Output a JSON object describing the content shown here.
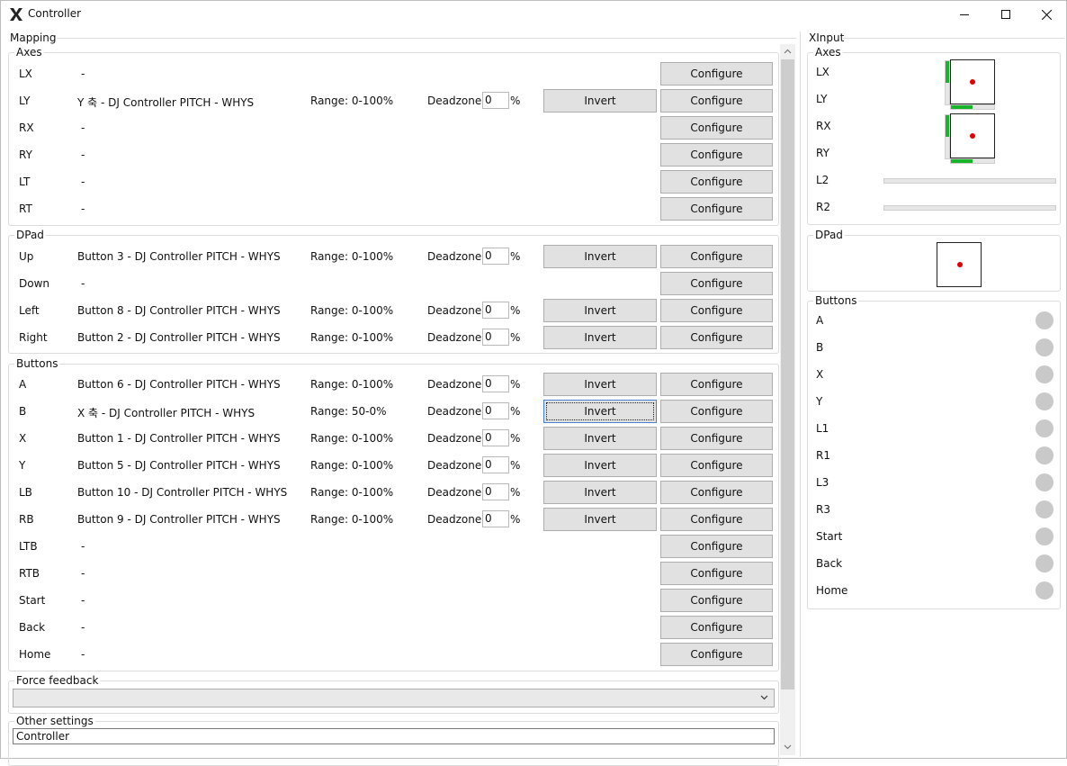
{
  "window": {
    "title": "Controller"
  },
  "mapping": {
    "title": "Mapping",
    "axes_title": "Axes",
    "axes": [
      {
        "name": "LX",
        "source": "-",
        "range": "",
        "deadzone": "",
        "has_invert": false
      },
      {
        "name": "LY",
        "source": "Y 축 - DJ Controller PITCH - WHYS",
        "range": "Range: 0-100%",
        "deadzone": "0",
        "has_invert": true
      },
      {
        "name": "RX",
        "source": "-",
        "range": "",
        "deadzone": "",
        "has_invert": false
      },
      {
        "name": "RY",
        "source": "-",
        "range": "",
        "deadzone": "",
        "has_invert": false
      },
      {
        "name": "LT",
        "source": "-",
        "range": "",
        "deadzone": "",
        "has_invert": false
      },
      {
        "name": "RT",
        "source": "-",
        "range": "",
        "deadzone": "",
        "has_invert": false
      }
    ],
    "dpad_title": "DPad",
    "dpad": [
      {
        "name": "Up",
        "source": "Button 3 - DJ Controller PITCH - WHYS",
        "range": "Range: 0-100%",
        "deadzone": "0",
        "has_invert": true
      },
      {
        "name": "Down",
        "source": "-",
        "range": "",
        "deadzone": "",
        "has_invert": false
      },
      {
        "name": "Left",
        "source": "Button 8 - DJ Controller PITCH - WHYS",
        "range": "Range: 0-100%",
        "deadzone": "0",
        "has_invert": true
      },
      {
        "name": "Right",
        "source": "Button 2 - DJ Controller PITCH - WHYS",
        "range": "Range: 0-100%",
        "deadzone": "0",
        "has_invert": true
      }
    ],
    "buttons_title": "Buttons",
    "buttons": [
      {
        "name": "A",
        "source": "Button 6 - DJ Controller PITCH - WHYS",
        "range": "Range: 0-100%",
        "deadzone": "0",
        "has_invert": true
      },
      {
        "name": "B",
        "source": "X 축 - DJ Controller PITCH - WHYS",
        "range": "Range: 50-0%",
        "deadzone": "0",
        "has_invert": true,
        "focused": true
      },
      {
        "name": "X",
        "source": "Button 1 - DJ Controller PITCH - WHYS",
        "range": "Range: 0-100%",
        "deadzone": "0",
        "has_invert": true
      },
      {
        "name": "Y",
        "source": "Button 5 - DJ Controller PITCH - WHYS",
        "range": "Range: 0-100%",
        "deadzone": "0",
        "has_invert": true
      },
      {
        "name": "LB",
        "source": "Button 10 - DJ Controller PITCH - WHYS",
        "range": "Range: 0-100%",
        "deadzone": "0",
        "has_invert": true
      },
      {
        "name": "RB",
        "source": "Button 9 - DJ Controller PITCH - WHYS",
        "range": "Range: 0-100%",
        "deadzone": "0",
        "has_invert": true
      },
      {
        "name": "LTB",
        "source": "-",
        "range": "",
        "deadzone": "",
        "has_invert": false
      },
      {
        "name": "RTB",
        "source": "-",
        "range": "",
        "deadzone": "",
        "has_invert": false
      },
      {
        "name": "Start",
        "source": "-",
        "range": "",
        "deadzone": "",
        "has_invert": false
      },
      {
        "name": "Back",
        "source": "-",
        "range": "",
        "deadzone": "",
        "has_invert": false
      },
      {
        "name": "Home",
        "source": "-",
        "range": "",
        "deadzone": "",
        "has_invert": false
      }
    ],
    "deadzone_label": "Deadzone:",
    "percent": "%",
    "invert_label": "Invert",
    "configure_label": "Configure",
    "force_feedback_title": "Force feedback",
    "force_feedback_value": "",
    "other_settings_title": "Other settings",
    "other_settings_name": "Controller"
  },
  "xinput": {
    "title": "XInput",
    "axes_title": "Axes",
    "axis_labels": [
      "LX",
      "LY",
      "RX",
      "RY",
      "L2",
      "R2"
    ],
    "left_stick": {
      "x_level": 0.5,
      "y_level": 0.5
    },
    "right_stick": {
      "x_level": 0.5,
      "y_level": 0.5
    },
    "l2_level": 0.0,
    "r2_level": 0.0,
    "dpad_title": "DPad",
    "buttons_title": "Buttons",
    "buttons": [
      "A",
      "B",
      "X",
      "Y",
      "L1",
      "R1",
      "L3",
      "R3",
      "Start",
      "Back",
      "Home"
    ]
  },
  "colors": {
    "accent_green": "#18b52a",
    "indicator_red": "#e00000",
    "led_off": "#c9c9c9"
  }
}
